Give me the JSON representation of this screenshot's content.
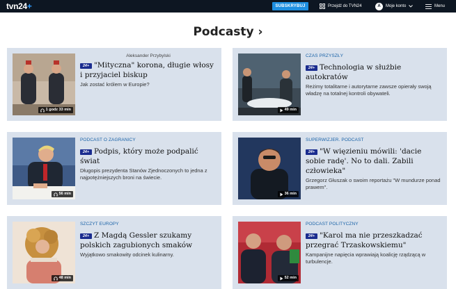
{
  "header": {
    "logo_main": "tvn24",
    "logo_plus": "+",
    "subscribe_label": "SUBSKRYBUJ",
    "goto_label": "Przejdź do TVN24",
    "account_initial": "A",
    "account_label": "Moje konto",
    "menu_label": "Menu"
  },
  "page": {
    "title": "Podcasty ›"
  },
  "badge_label": "24+",
  "cards": [
    {
      "category": "",
      "author": "Aleksander Przybylski",
      "title": "\"Mityczna\" korona, długie włosy i przyjaciel biskup",
      "description": "Jak zostać królem w Europie?",
      "duration": "1 godz 33 min"
    },
    {
      "category": "CZAS PRZYSZŁY",
      "author": "",
      "title": "Technologia w służbie autokratów",
      "description": "Reżimy totalitarne i autorytarne zawsze opierały swoją władzę na totalnej kontroli obywateli.",
      "duration": "49 min"
    },
    {
      "category": "PODCAST O ZAGRANICY",
      "author": "",
      "title": "Podpis, który może podpalić świat",
      "description": "Długopis prezydenta Stanów Zjednoczonych to jedna z najpotężniejszych broni na świecie.",
      "duration": "56 min"
    },
    {
      "category": "SUPERWIZJER. PODCAST",
      "author": "",
      "title": "\"W więzieniu mówili: 'dacie sobie radę'. No to dali. Zabili człowieka\"",
      "description": "Grzegorz Głuszak o swoim reportażu \"W mundurze ponad prawem\".",
      "duration": "36 min"
    },
    {
      "category": "SZCZYT EUROPY",
      "author": "",
      "title": "Z Magdą Gessler szukamy polskich zagubionych smaków",
      "description": "Wyjątkowo smakowity odcinek kulinarny.",
      "duration": "48 min"
    },
    {
      "category": "PODCAST POLITYCZNY",
      "author": "",
      "title": "\"Karol ma nie przeszkadzać przegrać Trzaskowskiemu\"",
      "description": "Kampanijne napięcia wprawiają koalicję rządzącą w turbulencje.",
      "duration": "52 min"
    }
  ]
}
